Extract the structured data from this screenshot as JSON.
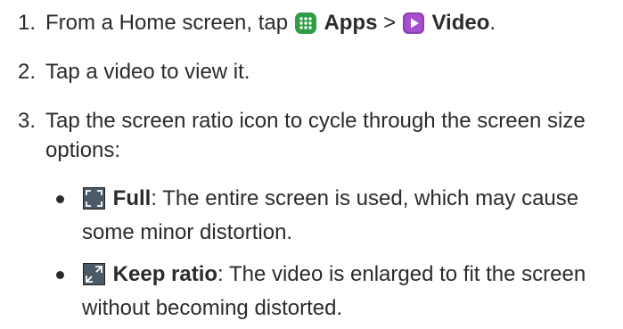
{
  "colors": {
    "text": "#2b2b2b",
    "apps_icon": "#2e9e44",
    "video_icon": "#8e3fb5",
    "ratio_icon_bg": "#4a5a66"
  },
  "steps": [
    {
      "number": "1.",
      "text_before": "From a Home screen, tap ",
      "apps_icon": "apps-grid-icon",
      "apps_label": "Apps",
      "separator": " > ",
      "video_icon": "video-play-icon",
      "video_label": "Video",
      "text_after": "."
    },
    {
      "number": "2.",
      "text": "Tap a video to view it."
    },
    {
      "number": "3.",
      "text": "Tap the screen ratio icon to cycle through the screen size options:"
    }
  ],
  "options": [
    {
      "icon": "full-screen-ratio-icon",
      "label": "Full",
      "description": ": The entire screen is used, which may cause some minor distortion."
    },
    {
      "icon": "keep-ratio-icon",
      "label": "Keep ratio",
      "description": ": The video is enlarged to fit the screen without becoming distorted."
    }
  ]
}
